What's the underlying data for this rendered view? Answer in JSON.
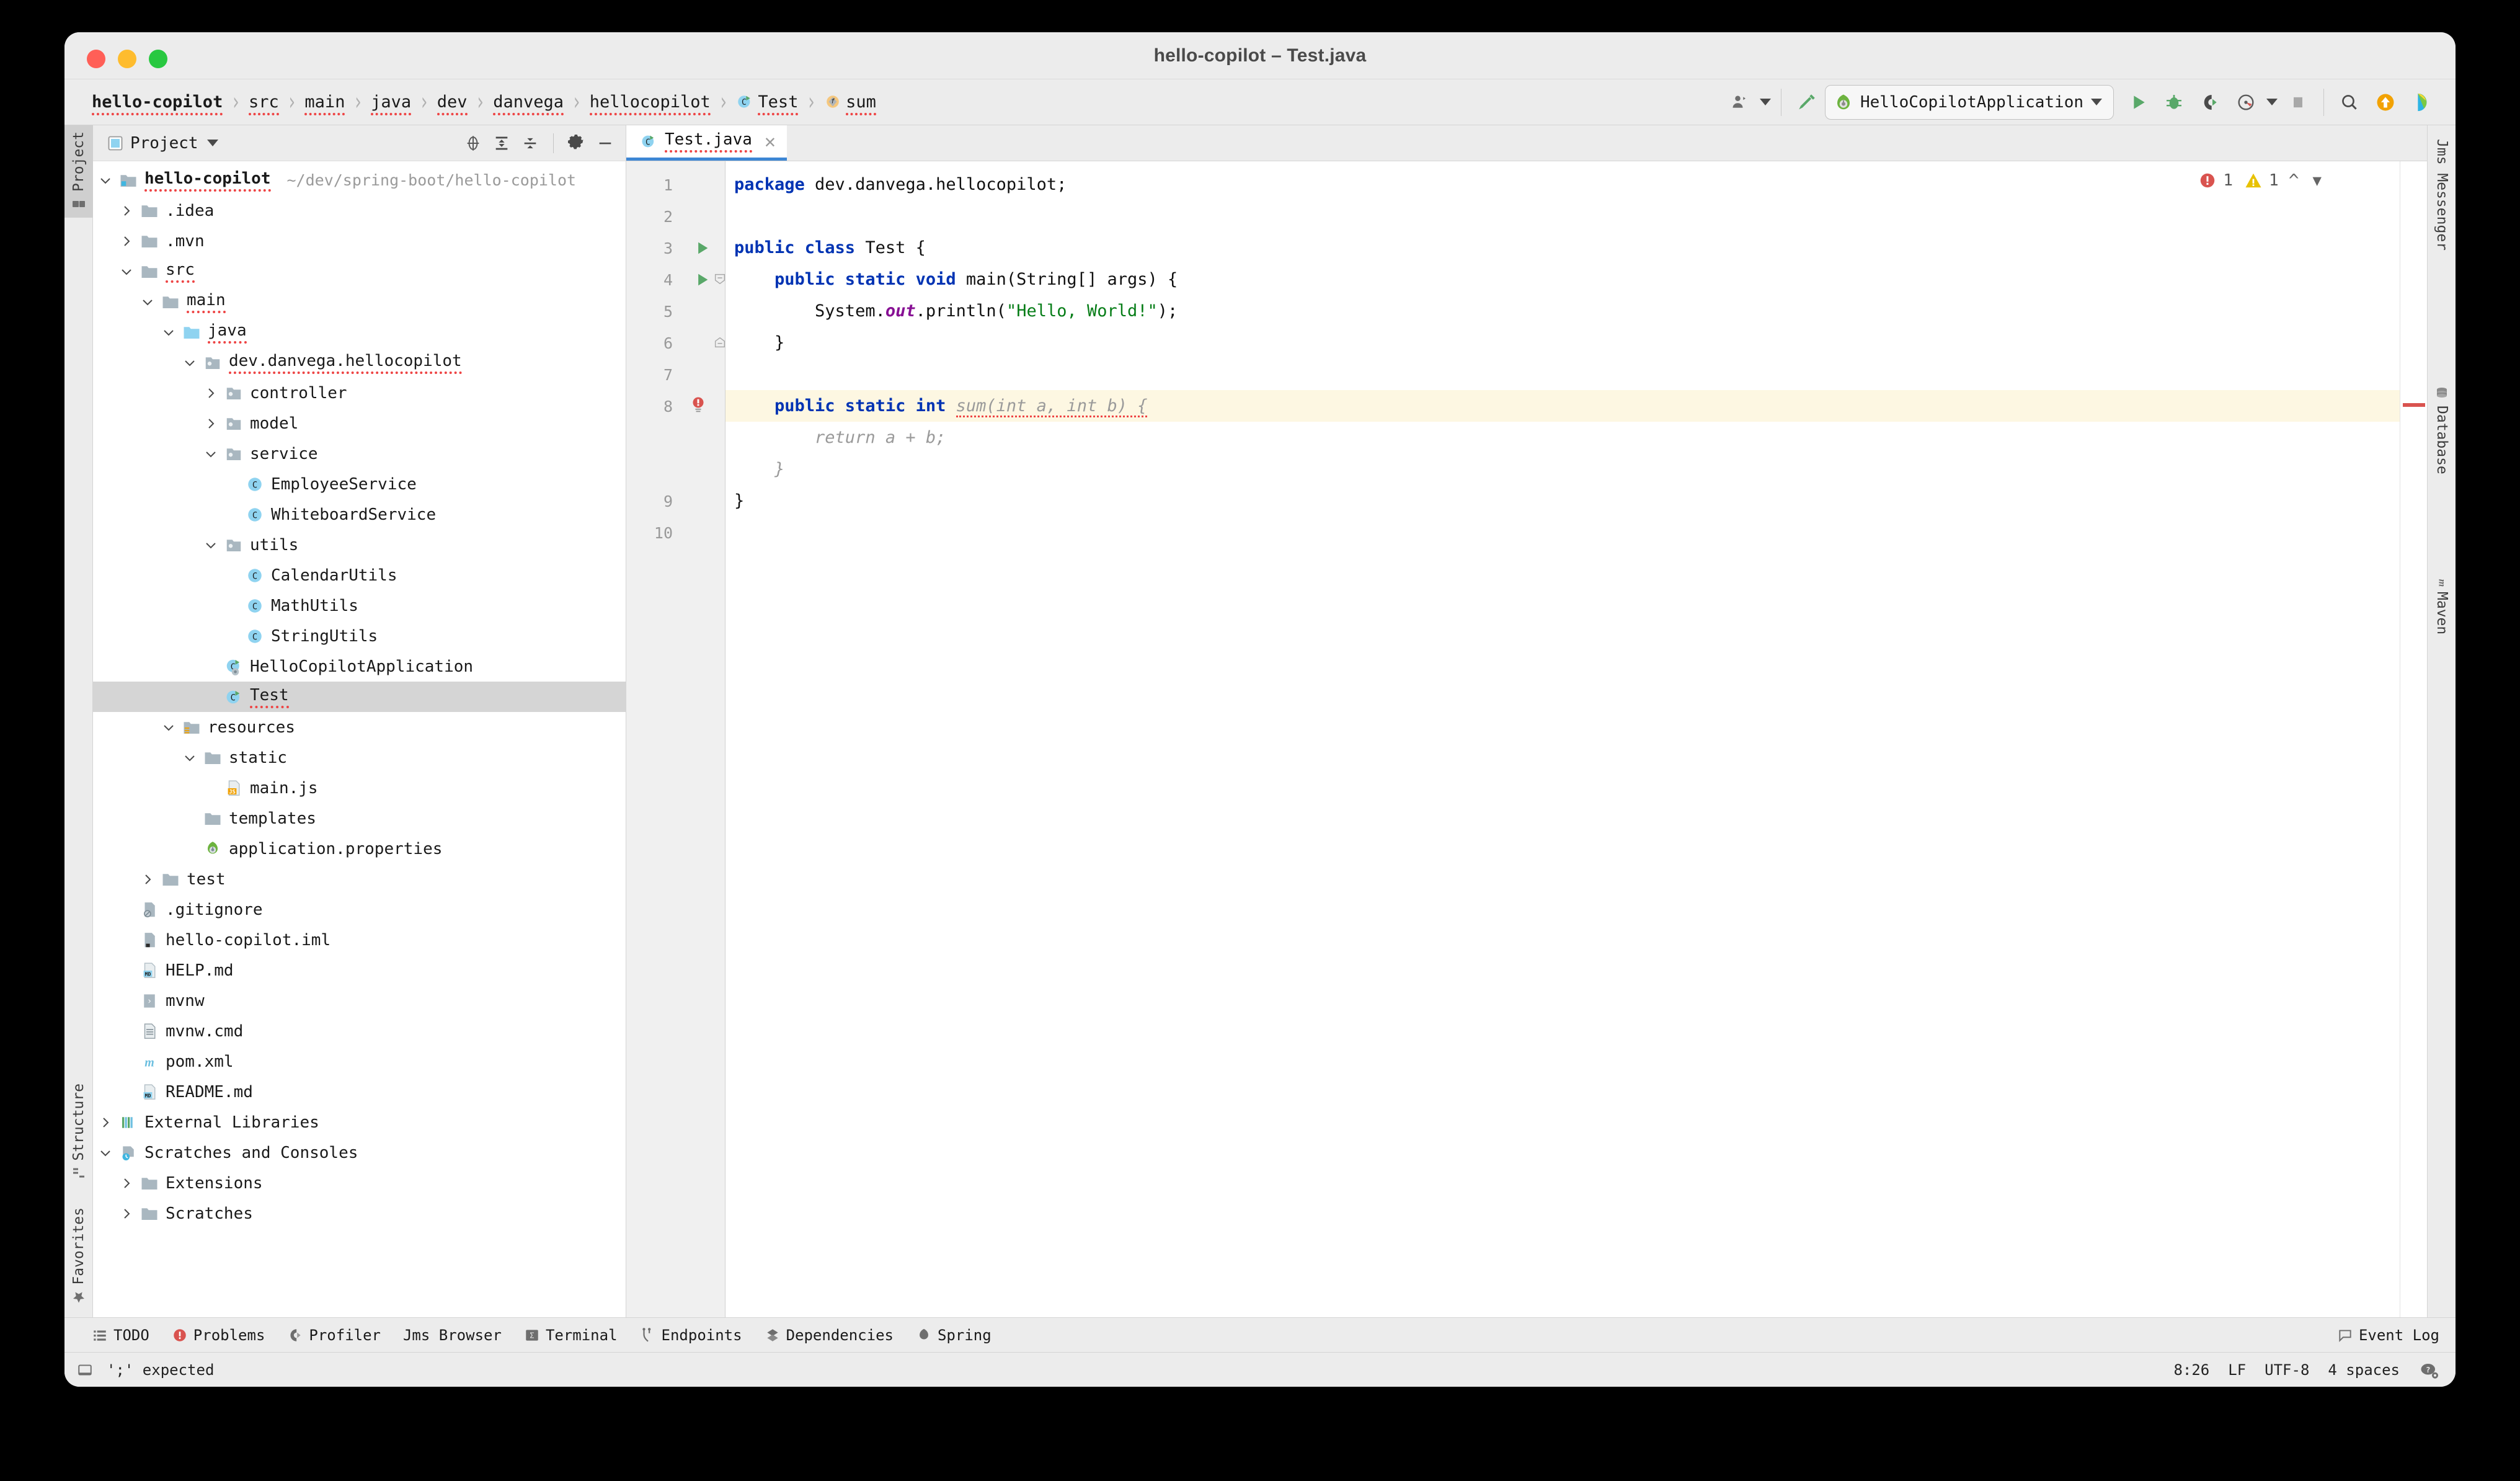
{
  "window": {
    "title": "hello-copilot – Test.java",
    "traffic_lights": [
      "close",
      "minimize",
      "zoom"
    ]
  },
  "breadcrumb": {
    "items": [
      {
        "label": "hello-copilot",
        "icon": "",
        "bold": true
      },
      {
        "label": "src",
        "icon": ""
      },
      {
        "label": "main",
        "icon": ""
      },
      {
        "label": "java",
        "icon": ""
      },
      {
        "label": "dev",
        "icon": ""
      },
      {
        "label": "danvega",
        "icon": ""
      },
      {
        "label": "hellocopilot",
        "icon": ""
      },
      {
        "label": "Test",
        "icon": "class-icon"
      },
      {
        "label": "sum",
        "icon": "method-icon"
      }
    ],
    "separator": "›"
  },
  "toolbar": {
    "profile_icon": "user-profile-icon",
    "build_icon": "hammer-build-icon",
    "run_config": {
      "icon": "spring-boot-icon",
      "label": "HelloCopilotApplication",
      "caret": "chevron-down-icon"
    },
    "run_label": "Run",
    "debug_label": "Debug",
    "rerun_label": "Run with Coverage",
    "profile_label": "Profile",
    "stop_label": "Stop",
    "search_label": "Search Everywhere",
    "update_label": "Update Project",
    "ai_label": "AI Assistant"
  },
  "left_rail": {
    "items": [
      {
        "label": "Project",
        "icon": "project-icon",
        "active": true
      },
      {
        "label": "Structure",
        "icon": "structure-icon",
        "active": false
      },
      {
        "label": "Favorites",
        "icon": "star-icon",
        "active": false
      }
    ]
  },
  "right_rail": {
    "items": [
      {
        "label": "Jms Messenger",
        "icon": ""
      },
      {
        "label": "Database",
        "icon": "database-icon"
      },
      {
        "label": "Maven",
        "icon": "maven-icon"
      }
    ]
  },
  "project_panel": {
    "title": "Project",
    "title_icon": "project-icon",
    "title_caret": "chevron-down-icon",
    "actions": [
      {
        "name": "select-opened-file-icon",
        "label": "Select Opened File"
      },
      {
        "name": "expand-all-icon",
        "label": "Expand All"
      },
      {
        "name": "collapse-all-icon",
        "label": "Collapse All"
      },
      {
        "name": "gear-icon",
        "label": "Options"
      },
      {
        "name": "minimize-icon",
        "label": "Hide"
      }
    ],
    "tree": [
      {
        "label": "hello-copilot",
        "path": "~/dev/spring-boot/hello-copilot",
        "depth": 0,
        "twisty": "down",
        "icon": "module-folder-icon",
        "bold": true,
        "squiggle": true
      },
      {
        "label": ".idea",
        "depth": 1,
        "twisty": "right",
        "icon": "folder-icon"
      },
      {
        "label": ".mvn",
        "depth": 1,
        "twisty": "right",
        "icon": "folder-icon"
      },
      {
        "label": "src",
        "depth": 1,
        "twisty": "down",
        "icon": "folder-icon",
        "squiggle": true
      },
      {
        "label": "main",
        "depth": 2,
        "twisty": "down",
        "icon": "folder-icon",
        "squiggle": true
      },
      {
        "label": "java",
        "depth": 3,
        "twisty": "down",
        "icon": "source-folder-icon",
        "squiggle": true
      },
      {
        "label": "dev.danvega.hellocopilot",
        "depth": 4,
        "twisty": "down",
        "icon": "package-icon",
        "squiggle": true
      },
      {
        "label": "controller",
        "depth": 5,
        "twisty": "right",
        "icon": "package-icon"
      },
      {
        "label": "model",
        "depth": 5,
        "twisty": "right",
        "icon": "package-icon"
      },
      {
        "label": "service",
        "depth": 5,
        "twisty": "down",
        "icon": "package-icon"
      },
      {
        "label": "EmployeeService",
        "depth": 6,
        "twisty": "",
        "icon": "class-icon"
      },
      {
        "label": "WhiteboardService",
        "depth": 6,
        "twisty": "",
        "icon": "class-icon"
      },
      {
        "label": "utils",
        "depth": 5,
        "twisty": "down",
        "icon": "package-icon"
      },
      {
        "label": "CalendarUtils",
        "depth": 6,
        "twisty": "",
        "icon": "class-icon"
      },
      {
        "label": "MathUtils",
        "depth": 6,
        "twisty": "",
        "icon": "class-icon"
      },
      {
        "label": "StringUtils",
        "depth": 6,
        "twisty": "",
        "icon": "class-icon"
      },
      {
        "label": "HelloCopilotApplication",
        "depth": 5,
        "twisty": "",
        "icon": "spring-class-icon"
      },
      {
        "label": "Test",
        "depth": 5,
        "twisty": "",
        "icon": "runnable-class-icon",
        "selected": true,
        "squiggle": true
      },
      {
        "label": "resources",
        "depth": 3,
        "twisty": "down",
        "icon": "resources-folder-icon"
      },
      {
        "label": "static",
        "depth": 4,
        "twisty": "down",
        "icon": "folder-icon"
      },
      {
        "label": "main.js",
        "depth": 5,
        "twisty": "",
        "icon": "js-file-icon"
      },
      {
        "label": "templates",
        "depth": 4,
        "twisty": "",
        "icon": "folder-icon"
      },
      {
        "label": "application.properties",
        "depth": 4,
        "twisty": "",
        "icon": "spring-properties-icon"
      },
      {
        "label": "test",
        "depth": 2,
        "twisty": "right",
        "icon": "folder-icon"
      },
      {
        "label": ".gitignore",
        "depth": 1,
        "twisty": "",
        "icon": "gitignore-file-icon"
      },
      {
        "label": "hello-copilot.iml",
        "depth": 1,
        "twisty": "",
        "icon": "iml-file-icon"
      },
      {
        "label": "HELP.md",
        "depth": 1,
        "twisty": "",
        "icon": "markdown-file-icon"
      },
      {
        "label": "mvnw",
        "depth": 1,
        "twisty": "",
        "icon": "shell-file-icon"
      },
      {
        "label": "mvnw.cmd",
        "depth": 1,
        "twisty": "",
        "icon": "text-file-icon"
      },
      {
        "label": "pom.xml",
        "depth": 1,
        "twisty": "",
        "icon": "maven-file-icon"
      },
      {
        "label": "README.md",
        "depth": 1,
        "twisty": "",
        "icon": "markdown-file-icon"
      },
      {
        "label": "External Libraries",
        "depth": 0,
        "twisty": "right",
        "icon": "libraries-icon"
      },
      {
        "label": "Scratches and Consoles",
        "depth": 0,
        "twisty": "down",
        "icon": "scratches-icon"
      },
      {
        "label": "Extensions",
        "depth": 1,
        "twisty": "right",
        "icon": "folder-icon"
      },
      {
        "label": "Scratches",
        "depth": 1,
        "twisty": "right",
        "icon": "folder-icon"
      }
    ]
  },
  "editor": {
    "tab": {
      "label": "Test.java",
      "icon": "runnable-class-icon",
      "close_icon": "close-icon",
      "active": true
    },
    "inspection": {
      "error_icon": "error-icon",
      "error_count": "1",
      "warning_icon": "warning-icon",
      "warning_count": "1",
      "prev_icon": "chevron-up-icon",
      "next_icon": "chevron-down-icon"
    },
    "line_numbers": [
      "1",
      "2",
      "3",
      "4",
      "5",
      "6",
      "7",
      "8",
      "9",
      "10"
    ],
    "lines": [
      {
        "num": "1",
        "tokens": [
          {
            "t": "package ",
            "c": "kw"
          },
          {
            "t": "dev.danvega.hellocopilot;",
            "c": "txt"
          }
        ]
      },
      {
        "num": "2",
        "tokens": []
      },
      {
        "num": "3",
        "gutter": "run-icon",
        "tokens": [
          {
            "t": "public class ",
            "c": "kw"
          },
          {
            "t": "Test {",
            "c": "txt"
          }
        ]
      },
      {
        "num": "4",
        "gutter": "run-icon",
        "fold": "fold-open-icon",
        "tokens": [
          {
            "t": "    public static void ",
            "c": "kw"
          },
          {
            "t": "main(String[] args) {",
            "c": "txt"
          }
        ]
      },
      {
        "num": "5",
        "tokens": [
          {
            "t": "        System.",
            "c": "txt"
          },
          {
            "t": "out",
            "c": "fld"
          },
          {
            "t": ".println(",
            "c": "txt"
          },
          {
            "t": "\"Hello, World!\"",
            "c": "str"
          },
          {
            "t": ");",
            "c": "txt"
          }
        ]
      },
      {
        "num": "6",
        "fold": "fold-close-icon",
        "tokens": [
          {
            "t": "    }",
            "c": "txt"
          }
        ]
      },
      {
        "num": "7",
        "tokens": []
      },
      {
        "num": "8",
        "gutter": "error-bulb-icon",
        "highlight": true,
        "tokens": [
          {
            "t": "    public static int ",
            "c": "kw"
          },
          {
            "t": "sum(int a, int b) {",
            "c": "ghost"
          }
        ]
      },
      {
        "num": "",
        "tokens": [
          {
            "t": "        return a + b;",
            "c": "ghost"
          }
        ]
      },
      {
        "num": "",
        "tokens": [
          {
            "t": "    }",
            "c": "ghost"
          }
        ]
      },
      {
        "num": "9",
        "tokens": [
          {
            "t": "}",
            "c": "txt"
          }
        ]
      },
      {
        "num": "10",
        "tokens": []
      }
    ]
  },
  "tool_windows": {
    "items": [
      {
        "label": "TODO",
        "icon": "todo-icon"
      },
      {
        "label": "Problems",
        "icon": "problems-icon"
      },
      {
        "label": "Profiler",
        "icon": "profiler-icon"
      },
      {
        "label": "Jms Browser",
        "icon": ""
      },
      {
        "label": "Terminal",
        "icon": "terminal-icon"
      },
      {
        "label": "Endpoints",
        "icon": "endpoints-icon"
      },
      {
        "label": "Dependencies",
        "icon": "dependencies-icon"
      },
      {
        "label": "Spring",
        "icon": "spring-icon"
      }
    ],
    "event_log": {
      "label": "Event Log",
      "icon": "event-log-icon"
    }
  },
  "status_bar": {
    "message_icon": "console-icon",
    "message": "';' expected",
    "position": "8:26",
    "line_separator": "LF",
    "encoding": "UTF-8",
    "indent": "4 spaces",
    "copilot_icon": "copilot-icon"
  },
  "colors": {
    "keyword": "#0033b3",
    "string": "#067d17",
    "field": "#871094",
    "ghost": "#9a9a9a",
    "error": "#d9534f",
    "warning": "#e8c200",
    "accent": "#3d86d4",
    "selection": "#d5d5d5",
    "line_highlight": "#fdf7e2"
  }
}
